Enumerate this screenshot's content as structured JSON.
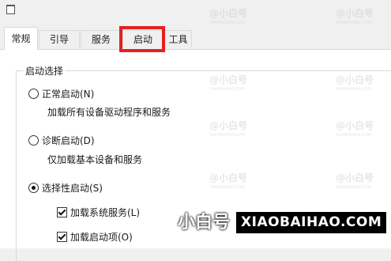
{
  "tabs": [
    {
      "label": "常规",
      "active": true
    },
    {
      "label": "引导",
      "active": false
    },
    {
      "label": "服务",
      "active": false
    },
    {
      "label": "启动",
      "active": false
    },
    {
      "label": "工具",
      "active": false
    }
  ],
  "startup": {
    "legend": "启动选择",
    "normal": {
      "label": "正常启动(N)",
      "desc": "加载所有设备驱动程序和服务",
      "checked": false
    },
    "diagnostic": {
      "label": "诊断启动(D)",
      "desc": "仅加载基本设备和服务",
      "checked": false
    },
    "selective": {
      "label": "选择性启动(S)",
      "checked": true
    },
    "load_services": {
      "label": "加载系统服务(L)",
      "checked": true
    },
    "load_startup": {
      "label": "加载启动项(O)",
      "checked": true
    }
  },
  "watermark": {
    "brand": "@小白号",
    "domain": "XIAOBAIHAO.COM",
    "big_brand": "小白号",
    "big_domain": "XIAOBAIHAO.COM"
  },
  "colors": {
    "highlight": "#e32121",
    "panel": "#ffffff",
    "background": "#f0f0f0"
  }
}
